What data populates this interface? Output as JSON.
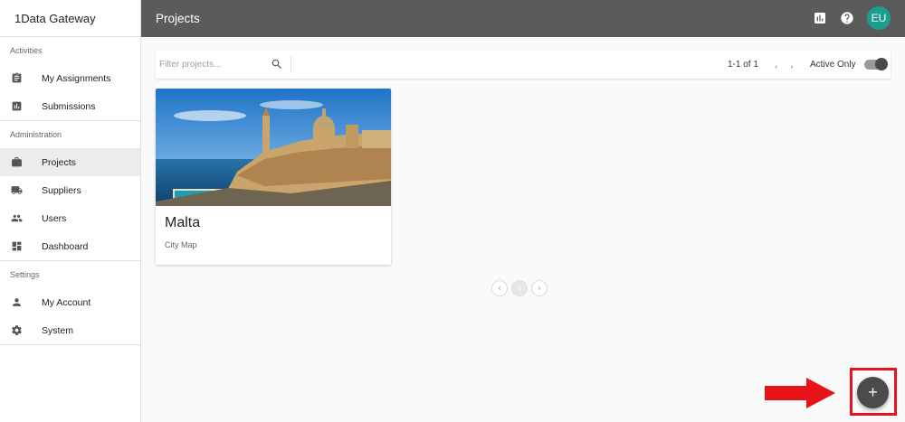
{
  "app": {
    "brand": "1Data Gateway",
    "page_title": "Projects",
    "user_initials": "EU"
  },
  "sidebar": {
    "sections": [
      {
        "title": "Activities",
        "items": [
          {
            "label": "My Assignments",
            "icon": "assignment-icon"
          },
          {
            "label": "Submissions",
            "icon": "chart-icon"
          }
        ]
      },
      {
        "title": "Administration",
        "items": [
          {
            "label": "Projects",
            "icon": "briefcase-icon",
            "active": true
          },
          {
            "label": "Suppliers",
            "icon": "truck-icon"
          },
          {
            "label": "Users",
            "icon": "people-icon"
          },
          {
            "label": "Dashboard",
            "icon": "dashboard-icon"
          }
        ]
      },
      {
        "title": "Settings",
        "items": [
          {
            "label": "My Account",
            "icon": "person-icon"
          },
          {
            "label": "System",
            "icon": "gear-icon"
          }
        ]
      }
    ]
  },
  "toolbar": {
    "filter_placeholder": "Filter projects...",
    "filter_value": "",
    "range_text": "1-1 of 1",
    "active_only_label": "Active Only",
    "active_only_on": true
  },
  "projects": [
    {
      "name": "Malta",
      "subtitle": "City Map"
    }
  ],
  "pagination": {
    "current_page": "1"
  },
  "fab": {
    "label": "+"
  },
  "colors": {
    "topbar": "#5b5b5b",
    "avatar": "#1b9e8f",
    "highlight": "#e8141a",
    "fab": "#4b4b4b"
  }
}
